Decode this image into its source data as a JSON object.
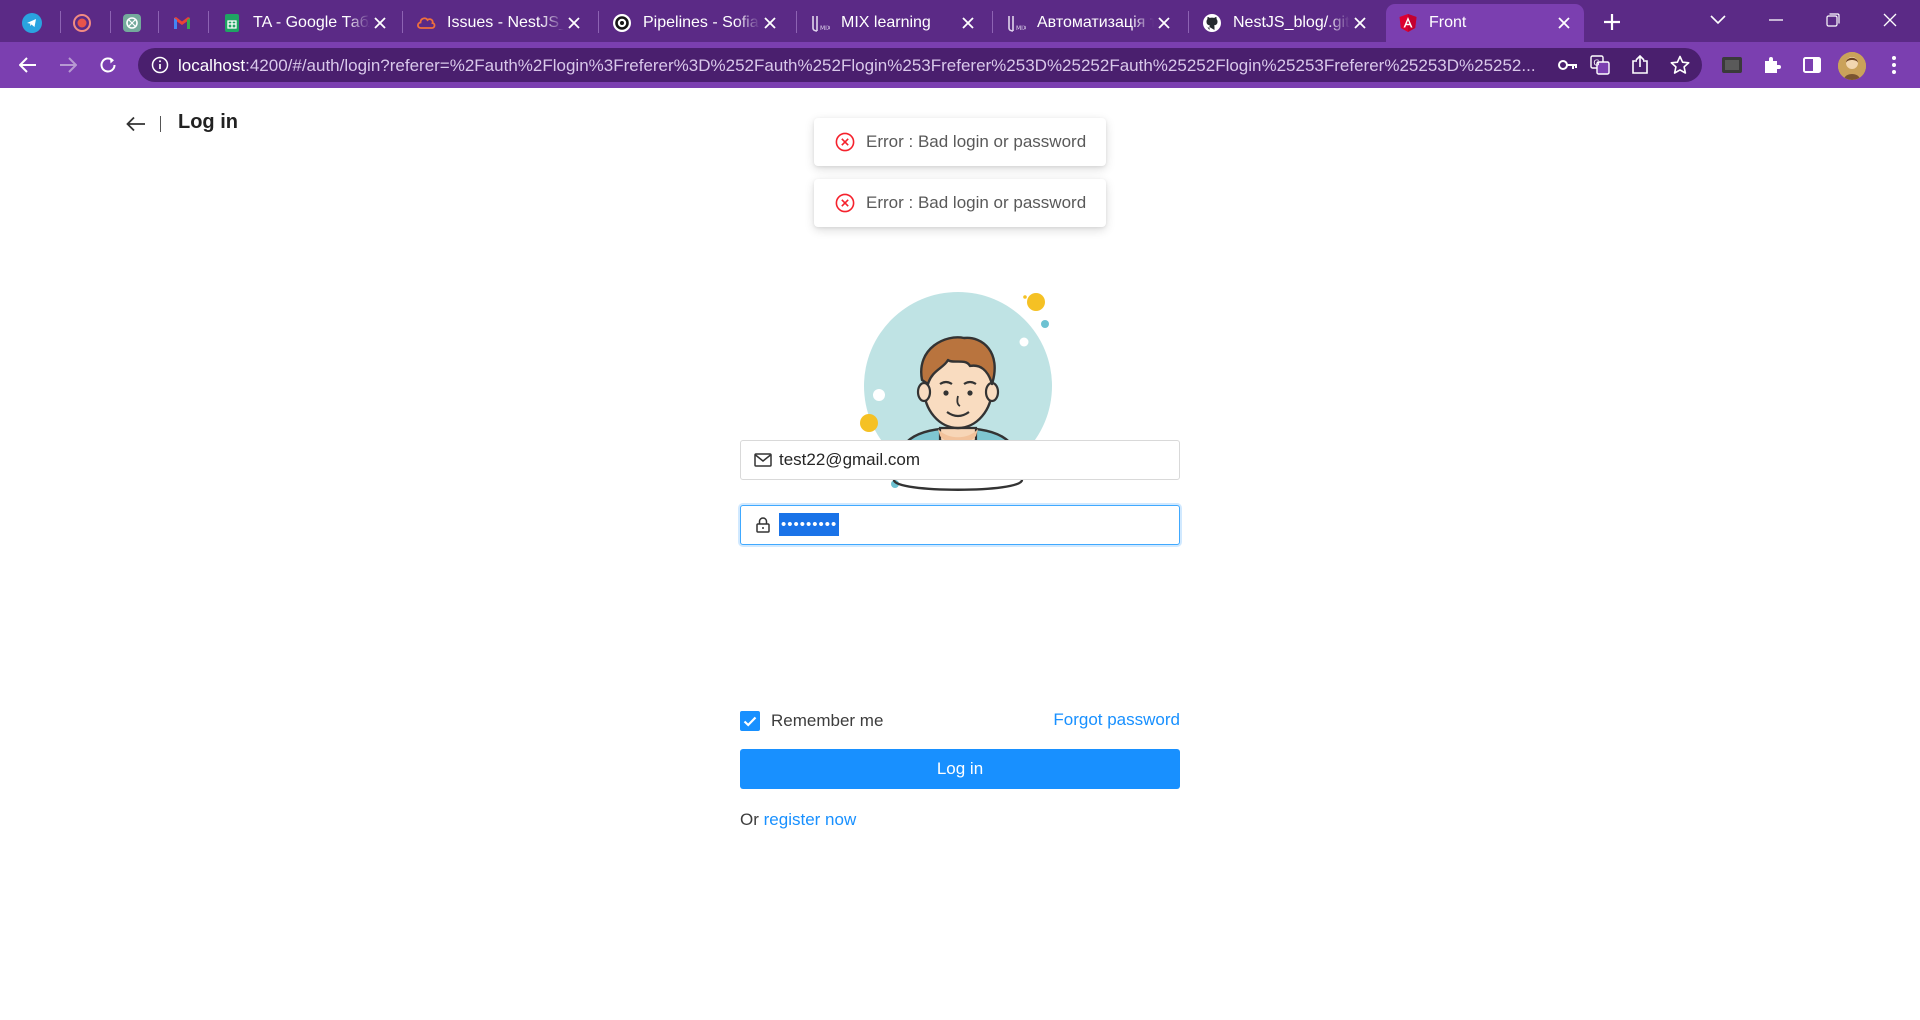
{
  "browser": {
    "tabs": [
      {
        "title": "",
        "icon": "telegram-icon"
      },
      {
        "title": "",
        "icon": "record-icon"
      },
      {
        "title": "",
        "icon": "chatgpt-icon"
      },
      {
        "title": "",
        "icon": "gmail-icon"
      },
      {
        "title": "TA - Google Табл",
        "icon": "google-sheets-icon"
      },
      {
        "title": "Issues - NestJS_bl",
        "icon": "cloud-icon"
      },
      {
        "title": "Pipelines - SofiaG",
        "icon": "circleci-icon"
      },
      {
        "title": "MIX learning",
        "icon": "mix-icon"
      },
      {
        "title": "Автоматизація те",
        "icon": "mix-icon"
      },
      {
        "title": "NestJS_blog/.gith",
        "icon": "github-icon"
      },
      {
        "title": "Front",
        "icon": "angular-icon"
      }
    ],
    "url_host": "localhost",
    "url_rest": ":4200/#/auth/login?referer=%2Fauth%2Flogin%3Freferer%3D%252Fauth%252Flogin%253Freferer%253D%25252Fauth%25252Flogin%25253Freferer%25253D%25252..."
  },
  "header": {
    "title": "Log in"
  },
  "toasts": [
    {
      "message": "Error : Bad login or password"
    },
    {
      "message": "Error : Bad login or password"
    }
  ],
  "form": {
    "email_value": "test22@gmail.com",
    "password_masked": "•••••••••",
    "remember_label": "Remember me",
    "remember_checked": true,
    "forgot_label": "Forgot password",
    "login_label": "Log in",
    "register_prefix": "Or",
    "register_link": "register now"
  },
  "colors": {
    "chrome_tabbar": "#5b2a86",
    "chrome_toolbar": "#7b3fb0",
    "primary": "#1890ff",
    "error": "#f5222d"
  }
}
